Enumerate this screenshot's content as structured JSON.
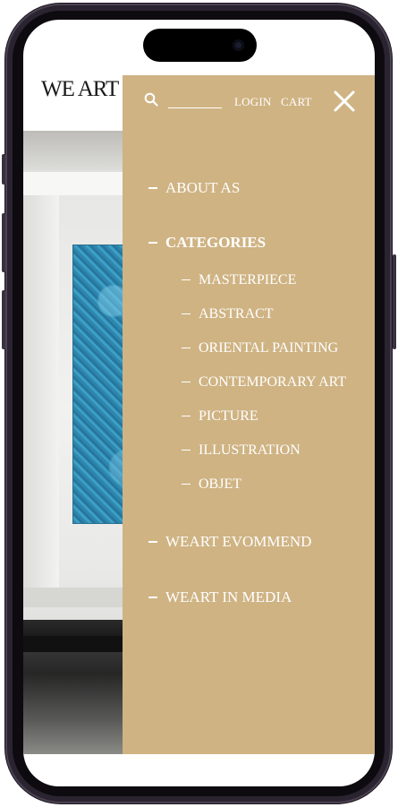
{
  "site": {
    "logo": "WE ART"
  },
  "menu": {
    "login_label": "LOGIN",
    "cart_label": "CART",
    "items": [
      {
        "label": "ABOUT AS",
        "level": 1,
        "active": false
      },
      {
        "label": "CATEGORIES",
        "level": 1,
        "active": true
      },
      {
        "label": "MASTERPIECE",
        "level": 2
      },
      {
        "label": "ABSTRACT",
        "level": 2
      },
      {
        "label": "ORIENTAL PAINTING",
        "level": 2
      },
      {
        "label": "CONTEMPORARY ART",
        "level": 2
      },
      {
        "label": "PICTURE",
        "level": 2
      },
      {
        "label": "ILLUSTRATION",
        "level": 2
      },
      {
        "label": "OBJET",
        "level": 2
      },
      {
        "label": "WEART EVOMMEND",
        "level": 1,
        "active": false
      },
      {
        "label": "WEART IN MEDIA",
        "level": 1,
        "active": false
      }
    ]
  },
  "colors": {
    "menu_background": "#cfb383",
    "menu_text": "#ffffff",
    "painting_accent": "#3592ba"
  },
  "icons": [
    "search-icon",
    "close-icon"
  ]
}
